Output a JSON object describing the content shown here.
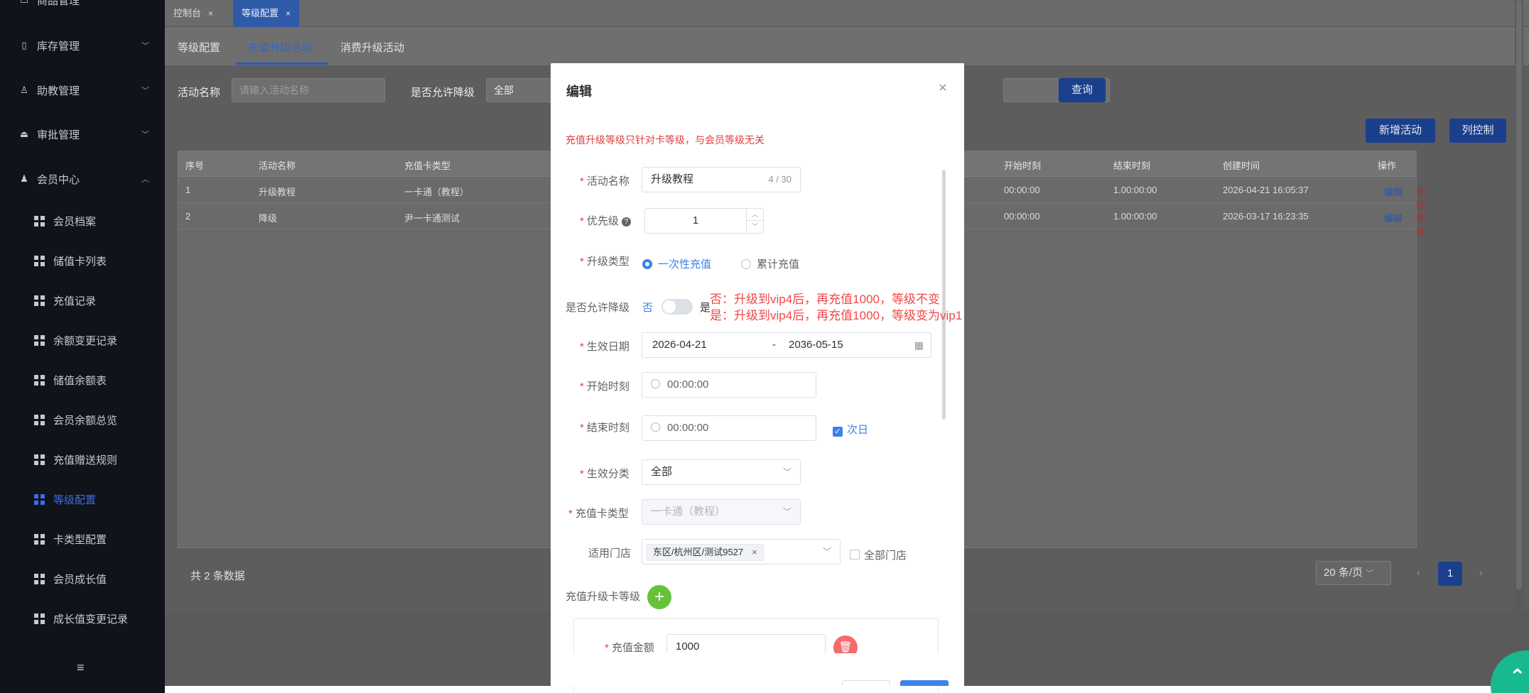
{
  "sidebar": {
    "top_item": "商品管理",
    "groups": [
      {
        "label": "库存管理",
        "icon": "inventory-icon"
      },
      {
        "label": "助教管理",
        "icon": "user-icon"
      },
      {
        "label": "审批管理",
        "icon": "approval-icon"
      },
      {
        "label": "会员中心",
        "icon": "member-icon"
      }
    ],
    "sub_items": [
      "会员档案",
      "储值卡列表",
      "充值记录",
      "余额变更记录",
      "储值余额表",
      "会员余额总览",
      "充值赠送规则",
      "等级配置",
      "卡类型配置",
      "会员成长值",
      "成长值变更记录"
    ],
    "active_sub": "等级配置",
    "collapse_glyph": "≡"
  },
  "tags": [
    {
      "label": "控制台",
      "close": "×"
    },
    {
      "label": "等级配置",
      "close": "×"
    }
  ],
  "subtabs": [
    "等级配置",
    "充值升级活动",
    "消费升级活动"
  ],
  "filters": {
    "name_label": "活动名称",
    "name_placeholder": "请输入活动名称",
    "downgrade_label": "是否允许降级",
    "downgrade_value": "全部",
    "query_button": "查询",
    "add_button": "新增活动",
    "columns_button": "列控制"
  },
  "table": {
    "headers": [
      "序号",
      "活动名称",
      "充值卡类型",
      "开始时刻",
      "结束时刻",
      "创建时间",
      "操作"
    ],
    "rows": [
      {
        "index": "1",
        "name": "升级教程",
        "card_type": "一卡通（教程）",
        "start": "00:00:00",
        "end": "1.00:00:00",
        "created": "2026-04-21 16:05:37",
        "edit": "编辑",
        "delete": "删除"
      },
      {
        "index": "2",
        "name": "降级",
        "card_type": "尹一卡通测试",
        "start": "00:00:00",
        "end": "1.00:00:00",
        "created": "2026-03-17 16:23:35",
        "edit": "编辑",
        "delete": "删除"
      }
    ]
  },
  "pager": {
    "total": "共 2 条数据",
    "page_size": "20 条/页",
    "current": "1",
    "prev": "‹",
    "next": "›"
  },
  "modal": {
    "title": "编辑",
    "close": "×",
    "note": "充值升级等级只针对卡等级，与会员等级无关",
    "required_mark": "*",
    "activity_name_label": "活动名称",
    "activity_name_value": "升级教程",
    "activity_name_counter": "4 / 30",
    "priority_label": "优先级",
    "priority_help": "?",
    "priority_value": "1",
    "stepper_up": "︿",
    "stepper_down": "﹀",
    "upgrade_type_label": "升级类型",
    "upgrade_type_options": [
      "一次性充值",
      "累计充值"
    ],
    "upgrade_type_selected": "一次性充值",
    "downgrade_label": "是否允许降级",
    "downgrade_off": "否",
    "downgrade_on": "是",
    "downgrade_enabled": false,
    "hint_no": "否：升级到vip4后，再充值1000，等级不变",
    "hint_yes": "是：升级到vip4后，再充值1000，等级变为vip1",
    "effective_date_label": "生效日期",
    "effective_start": "2026-04-21",
    "date_separator": "-",
    "effective_end": "2036-05-15",
    "start_time_label": "开始时刻",
    "start_time_value": "00:00:00",
    "end_time_label": "结束时刻",
    "end_time_value": "00:00:00",
    "next_day_label": "次日",
    "next_day_checked": true,
    "check_glyph": "✓",
    "category_label": "生效分类",
    "category_value": "全部",
    "card_type_label": "充值卡类型",
    "card_type_value": "一卡通（教程）",
    "store_label": "适用门店",
    "store_tag": "东区/杭州区/测试9527",
    "all_stores_label": "全部门店",
    "all_stores_checked": false,
    "levels_label": "充值升级卡等级",
    "add_glyph": "+",
    "recharge_amount_label": "充值金额",
    "recharge_amount_value": "1000"
  },
  "colors": {
    "sidebar_bg": "#11131b",
    "accent": "#3a83e8",
    "danger": "#f56c6c",
    "success": "#67c23a",
    "hint_red": "#f04848"
  }
}
